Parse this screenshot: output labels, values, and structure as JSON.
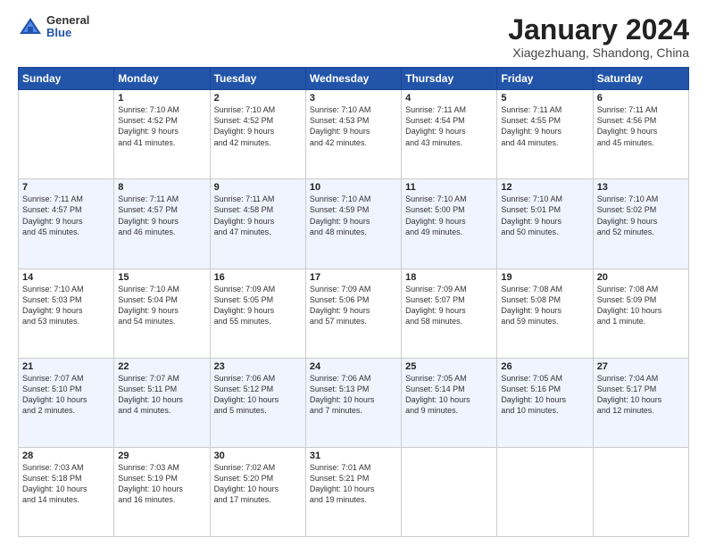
{
  "logo": {
    "general": "General",
    "blue": "Blue"
  },
  "title": "January 2024",
  "location": "Xiagezhuang, Shandong, China",
  "days_header": [
    "Sunday",
    "Monday",
    "Tuesday",
    "Wednesday",
    "Thursday",
    "Friday",
    "Saturday"
  ],
  "weeks": [
    [
      {
        "day": "",
        "info": ""
      },
      {
        "day": "1",
        "info": "Sunrise: 7:10 AM\nSunset: 4:52 PM\nDaylight: 9 hours\nand 41 minutes."
      },
      {
        "day": "2",
        "info": "Sunrise: 7:10 AM\nSunset: 4:52 PM\nDaylight: 9 hours\nand 42 minutes."
      },
      {
        "day": "3",
        "info": "Sunrise: 7:10 AM\nSunset: 4:53 PM\nDaylight: 9 hours\nand 42 minutes."
      },
      {
        "day": "4",
        "info": "Sunrise: 7:11 AM\nSunset: 4:54 PM\nDaylight: 9 hours\nand 43 minutes."
      },
      {
        "day": "5",
        "info": "Sunrise: 7:11 AM\nSunset: 4:55 PM\nDaylight: 9 hours\nand 44 minutes."
      },
      {
        "day": "6",
        "info": "Sunrise: 7:11 AM\nSunset: 4:56 PM\nDaylight: 9 hours\nand 45 minutes."
      }
    ],
    [
      {
        "day": "7",
        "info": "Sunrise: 7:11 AM\nSunset: 4:57 PM\nDaylight: 9 hours\nand 45 minutes."
      },
      {
        "day": "8",
        "info": "Sunrise: 7:11 AM\nSunset: 4:57 PM\nDaylight: 9 hours\nand 46 minutes."
      },
      {
        "day": "9",
        "info": "Sunrise: 7:11 AM\nSunset: 4:58 PM\nDaylight: 9 hours\nand 47 minutes."
      },
      {
        "day": "10",
        "info": "Sunrise: 7:10 AM\nSunset: 4:59 PM\nDaylight: 9 hours\nand 48 minutes."
      },
      {
        "day": "11",
        "info": "Sunrise: 7:10 AM\nSunset: 5:00 PM\nDaylight: 9 hours\nand 49 minutes."
      },
      {
        "day": "12",
        "info": "Sunrise: 7:10 AM\nSunset: 5:01 PM\nDaylight: 9 hours\nand 50 minutes."
      },
      {
        "day": "13",
        "info": "Sunrise: 7:10 AM\nSunset: 5:02 PM\nDaylight: 9 hours\nand 52 minutes."
      }
    ],
    [
      {
        "day": "14",
        "info": "Sunrise: 7:10 AM\nSunset: 5:03 PM\nDaylight: 9 hours\nand 53 minutes."
      },
      {
        "day": "15",
        "info": "Sunrise: 7:10 AM\nSunset: 5:04 PM\nDaylight: 9 hours\nand 54 minutes."
      },
      {
        "day": "16",
        "info": "Sunrise: 7:09 AM\nSunset: 5:05 PM\nDaylight: 9 hours\nand 55 minutes."
      },
      {
        "day": "17",
        "info": "Sunrise: 7:09 AM\nSunset: 5:06 PM\nDaylight: 9 hours\nand 57 minutes."
      },
      {
        "day": "18",
        "info": "Sunrise: 7:09 AM\nSunset: 5:07 PM\nDaylight: 9 hours\nand 58 minutes."
      },
      {
        "day": "19",
        "info": "Sunrise: 7:08 AM\nSunset: 5:08 PM\nDaylight: 9 hours\nand 59 minutes."
      },
      {
        "day": "20",
        "info": "Sunrise: 7:08 AM\nSunset: 5:09 PM\nDaylight: 10 hours\nand 1 minute."
      }
    ],
    [
      {
        "day": "21",
        "info": "Sunrise: 7:07 AM\nSunset: 5:10 PM\nDaylight: 10 hours\nand 2 minutes."
      },
      {
        "day": "22",
        "info": "Sunrise: 7:07 AM\nSunset: 5:11 PM\nDaylight: 10 hours\nand 4 minutes."
      },
      {
        "day": "23",
        "info": "Sunrise: 7:06 AM\nSunset: 5:12 PM\nDaylight: 10 hours\nand 5 minutes."
      },
      {
        "day": "24",
        "info": "Sunrise: 7:06 AM\nSunset: 5:13 PM\nDaylight: 10 hours\nand 7 minutes."
      },
      {
        "day": "25",
        "info": "Sunrise: 7:05 AM\nSunset: 5:14 PM\nDaylight: 10 hours\nand 9 minutes."
      },
      {
        "day": "26",
        "info": "Sunrise: 7:05 AM\nSunset: 5:16 PM\nDaylight: 10 hours\nand 10 minutes."
      },
      {
        "day": "27",
        "info": "Sunrise: 7:04 AM\nSunset: 5:17 PM\nDaylight: 10 hours\nand 12 minutes."
      }
    ],
    [
      {
        "day": "28",
        "info": "Sunrise: 7:03 AM\nSunset: 5:18 PM\nDaylight: 10 hours\nand 14 minutes."
      },
      {
        "day": "29",
        "info": "Sunrise: 7:03 AM\nSunset: 5:19 PM\nDaylight: 10 hours\nand 16 minutes."
      },
      {
        "day": "30",
        "info": "Sunrise: 7:02 AM\nSunset: 5:20 PM\nDaylight: 10 hours\nand 17 minutes."
      },
      {
        "day": "31",
        "info": "Sunrise: 7:01 AM\nSunset: 5:21 PM\nDaylight: 10 hours\nand 19 minutes."
      },
      {
        "day": "",
        "info": ""
      },
      {
        "day": "",
        "info": ""
      },
      {
        "day": "",
        "info": ""
      }
    ]
  ]
}
